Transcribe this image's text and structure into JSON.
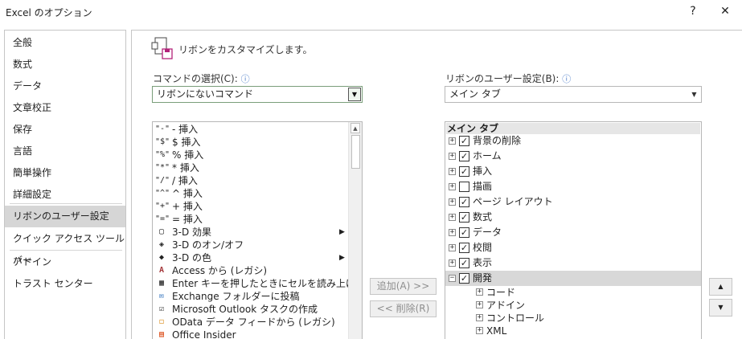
{
  "window": {
    "title": "Excel のオプション",
    "help": "?",
    "close": "✕"
  },
  "nav": {
    "items": [
      {
        "label": "全般"
      },
      {
        "label": "数式"
      },
      {
        "label": "データ"
      },
      {
        "label": "文章校正"
      },
      {
        "label": "保存"
      },
      {
        "label": "言語"
      },
      {
        "label": "簡単操作"
      },
      {
        "label": "詳細設定"
      },
      {
        "label": "リボンのユーザー設定",
        "selected": true
      },
      {
        "label": "クイック アクセス ツール バー"
      },
      {
        "label": "アドイン"
      },
      {
        "label": "トラスト センター"
      }
    ]
  },
  "main": {
    "heading": "リボンをカスタマイズします。",
    "commands_label": "コマンドの選択(C):",
    "commands_value": "リボンにないコマンド",
    "ribbon_label": "リボンのユーザー設定(B):",
    "ribbon_value": "メイン タブ",
    "info_icon": "ⓘ",
    "add_button": "追加(A) >>",
    "remove_button": "<< 削除(R)",
    "commands": [
      {
        "icon": "\"-\"",
        "text": "- 挿入"
      },
      {
        "icon": "\"$\"",
        "text": "$ 挿入"
      },
      {
        "icon": "\"%\"",
        "text": "% 挿入"
      },
      {
        "icon": "\"*\"",
        "text": "* 挿入"
      },
      {
        "icon": "\"/\"",
        "text": "/ 挿入"
      },
      {
        "icon": "\"^\"",
        "text": "^ 挿入"
      },
      {
        "icon": "\"+\"",
        "text": "+ 挿入"
      },
      {
        "icon": "\"=\"",
        "text": "= 挿入"
      },
      {
        "icon": "▢",
        "text": "3-D 効果",
        "submenu": true
      },
      {
        "icon": "◈",
        "text": "3-D のオン/オフ"
      },
      {
        "icon": "◆",
        "text": "3-D の色",
        "submenu": true
      },
      {
        "icon": "A",
        "text": "Access から (レガシ)"
      },
      {
        "icon": "▦",
        "text": "Enter キーを押したときにセルを読み上げ"
      },
      {
        "icon": "✉",
        "text": "Exchange フォルダーに投稿"
      },
      {
        "icon": "☑",
        "text": "Microsoft Outlook タスクの作成"
      },
      {
        "icon": "◻",
        "text": "OData データ フィードから (レガシ)"
      },
      {
        "icon": "▤",
        "text": "Office Insider"
      }
    ],
    "tree_header": "メイン タブ",
    "tabs": [
      {
        "label": "背景の削除",
        "checked": true
      },
      {
        "label": "ホーム",
        "checked": true
      },
      {
        "label": "挿入",
        "checked": true
      },
      {
        "label": "描画",
        "checked": false
      },
      {
        "label": "ページ レイアウト",
        "checked": true
      },
      {
        "label": "数式",
        "checked": true
      },
      {
        "label": "データ",
        "checked": true
      },
      {
        "label": "校閲",
        "checked": true
      },
      {
        "label": "表示",
        "checked": true
      },
      {
        "label": "開発",
        "checked": true,
        "expanded": true
      }
    ],
    "dev_groups": [
      {
        "label": "コード"
      },
      {
        "label": "アドイン"
      },
      {
        "label": "コントロール"
      },
      {
        "label": "XML"
      }
    ]
  }
}
